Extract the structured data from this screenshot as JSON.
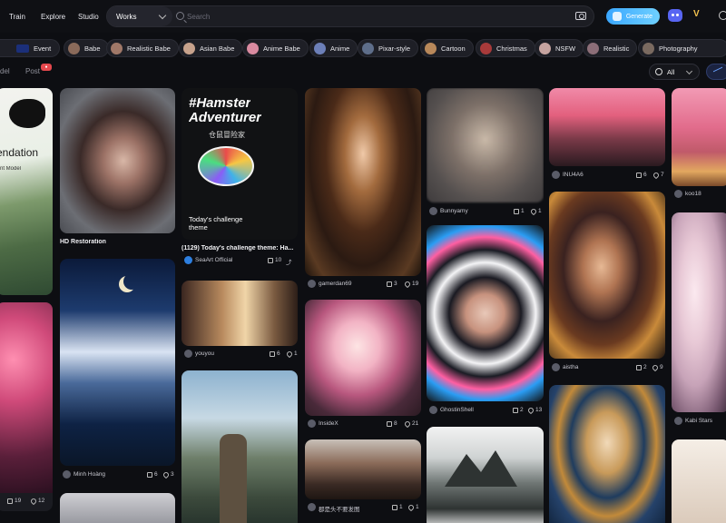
{
  "header": {
    "nav": [
      "Train",
      "Explore",
      "Studio"
    ],
    "search_scope": "Works",
    "search_placeholder": "Search",
    "generate_label": "Generate"
  },
  "tags": [
    "Event",
    "Babe",
    "Realistic Babe",
    "Asian Babe",
    "Anime Babe",
    "Anime",
    "Pixar-style",
    "Cartoon",
    "Christmas",
    "NSFW",
    "Realistic",
    "Photography"
  ],
  "subtabs": {
    "model": "del",
    "post": "Post",
    "time_filter": "All"
  },
  "cards": {
    "c1": {
      "text": "endation",
      "subtext": "nt Model"
    },
    "c2": {
      "caption": "HD Restoration"
    },
    "c3": {
      "title_line1": "#Hamster",
      "title_line2": "Adventurer",
      "cn_title": "仓鼠冒险家",
      "bottom_text": "Today's challenge theme",
      "caption": "(1129) Today's challenge theme: Ha...",
      "author": "SeaArt Official",
      "likes": "10"
    },
    "c4": {
      "author": "gamerdan69",
      "likes": "3",
      "hearts": "19"
    },
    "c5": {
      "author": "Bunnyamy",
      "likes": "1",
      "hearts": "1"
    },
    "c6": {
      "author": "INU4A6",
      "likes": "6",
      "hearts": "7"
    },
    "c7": {
      "author": "koo18"
    },
    "c8": {
      "author": "Minh Hoàng",
      "likes": "6",
      "hearts": "3"
    },
    "c9": {
      "author": "youyou",
      "likes": "6",
      "hearts": "1"
    },
    "c10": {
      "author": "InsideX",
      "likes": "8",
      "hearts": "21"
    },
    "c11": {
      "author": "GhostinShell",
      "likes": "2",
      "hearts": "13"
    },
    "c12": {
      "author": "aistha",
      "likes": "2",
      "hearts": "9"
    },
    "c13": {
      "author": "Kabi Stars"
    },
    "c14": {
      "likes": "19",
      "hearts": "12"
    },
    "c15": {
      "author": "郡是头不要发图",
      "likes": "1",
      "hearts": "1"
    }
  }
}
